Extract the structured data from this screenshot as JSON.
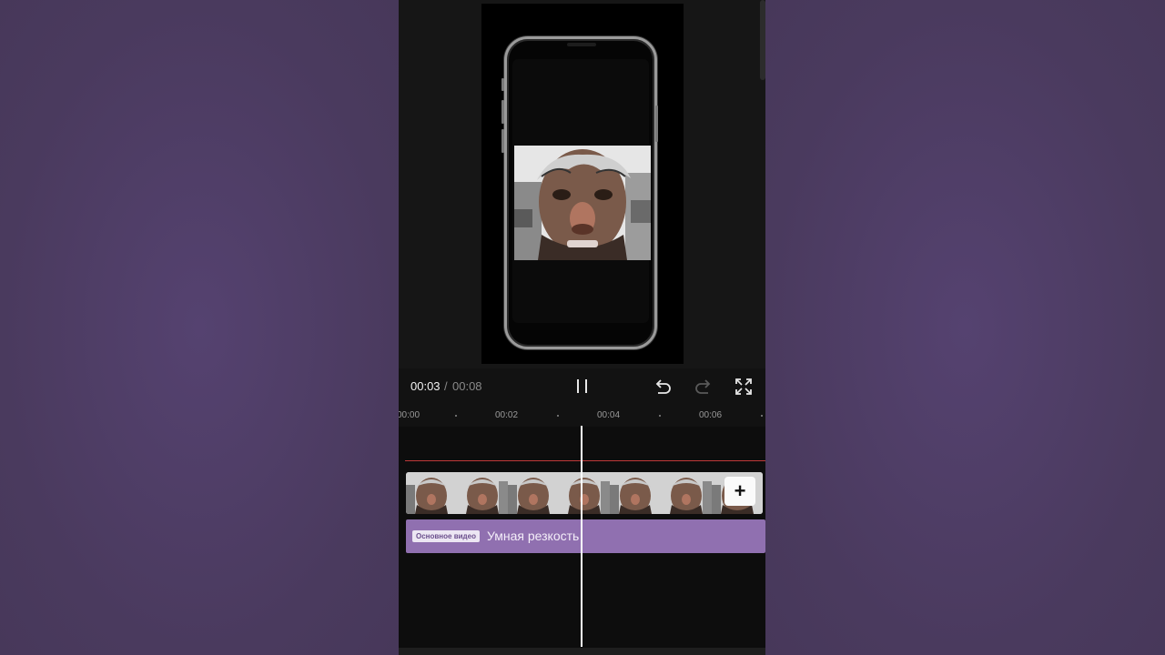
{
  "player": {
    "time_current": "00:03",
    "time_separator": "/",
    "time_total": "00:08",
    "play_state_icon": "pause-icon",
    "undo_icon": "undo-icon",
    "redo_icon": "redo-icon",
    "fullscreen_icon": "fullscreen-icon"
  },
  "ruler": {
    "ticks": [
      "00:00",
      "00:02",
      "00:04",
      "00:06"
    ]
  },
  "timeline": {
    "add_clip_label": "+",
    "main_video_badge": "Основное видео",
    "track_effect_label": "Умная резкость",
    "track_color": "#9070b0",
    "playhead_color": "#ffffff"
  },
  "colors": {
    "background": "#4f3d63",
    "app_background": "#121212"
  }
}
